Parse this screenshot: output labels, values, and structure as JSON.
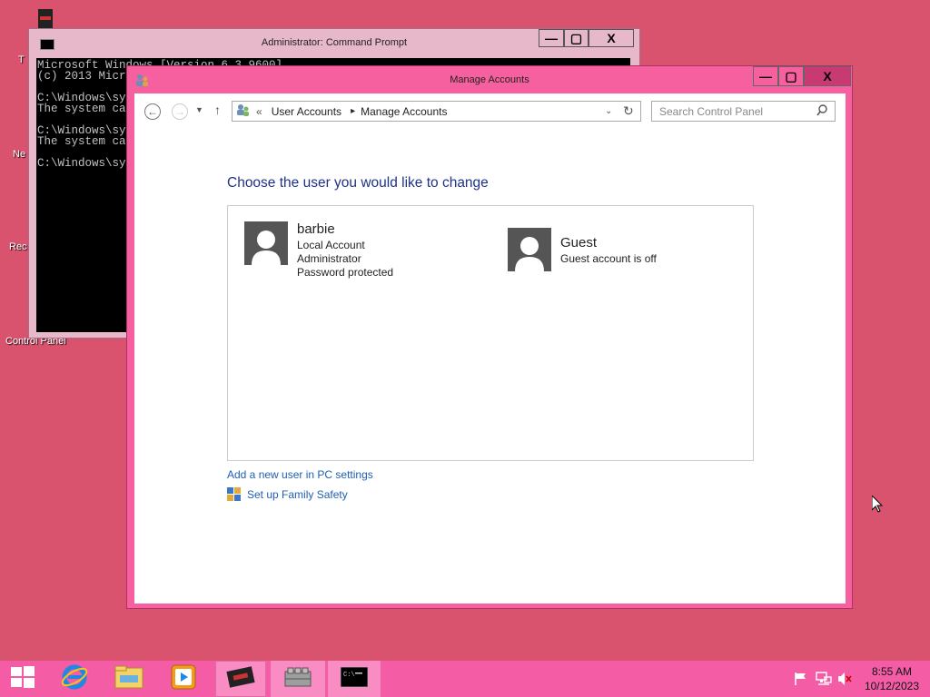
{
  "desktop": {
    "icons": [
      {
        "label": "T",
        "icon": "recycle-like-icon"
      },
      {
        "label": "Ne",
        "icon": "network-icon"
      },
      {
        "label": "Rec",
        "icon": "recycle-bin-icon"
      },
      {
        "label": "Control Panel",
        "icon": "control-panel-icon"
      }
    ]
  },
  "cmd": {
    "title": "Administrator: Command Prompt",
    "lines": [
      "Microsoft Windows [Version 6.3.9600]",
      "(c) 2013 Micr",
      "",
      "C:\\Windows\\sy",
      "The system ca",
      "",
      "C:\\Windows\\sy",
      "The system ca",
      "",
      "C:\\Windows\\sy"
    ],
    "buttons": {
      "minimize": "—",
      "maximize": "▢",
      "close": "X"
    }
  },
  "manage_accounts": {
    "title": "Manage Accounts",
    "buttons": {
      "minimize": "—",
      "maximize": "▢",
      "close": "X"
    },
    "breadcrumb": {
      "prefix": "«",
      "items": [
        "User Accounts",
        "Manage Accounts"
      ],
      "separator": "▸"
    },
    "search_placeholder": "Search Control Panel",
    "heading": "Choose the user you would like to change",
    "accounts": [
      {
        "name": "barbie",
        "details": [
          "Local Account",
          "Administrator",
          "Password protected"
        ]
      },
      {
        "name": "Guest",
        "details": [
          "Guest account is off"
        ]
      }
    ],
    "links": {
      "add_user": "Add a new user in PC settings",
      "family_safety": "Set up Family Safety"
    }
  },
  "taskbar": {
    "items": [
      "start-icon",
      "internet-explorer-icon",
      "file-explorer-icon",
      "media-player-icon",
      "app-active-icon",
      "server-manager-icon",
      "command-prompt-icon"
    ],
    "time": "8:55 AM",
    "date": "10/12/2023"
  },
  "colors": {
    "desktop": "#d9536f",
    "accent": "#f7609e",
    "heading": "#1e3287",
    "link": "#1e5fb4"
  }
}
